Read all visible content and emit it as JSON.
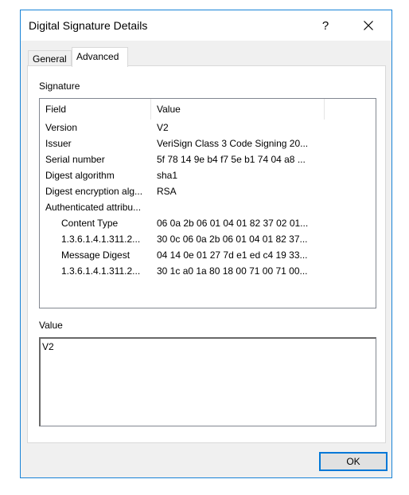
{
  "window": {
    "title": "Digital Signature Details",
    "help_label": "?",
    "close_icon": "close-icon"
  },
  "tabs": [
    {
      "label": "General",
      "selected": false
    },
    {
      "label": "Advanced",
      "selected": true
    }
  ],
  "signature": {
    "group_label": "Signature",
    "columns": [
      "Field",
      "Value"
    ],
    "rows": [
      {
        "field": "Version",
        "value": "V2",
        "indent": false
      },
      {
        "field": "Issuer",
        "value": "VeriSign Class 3 Code Signing 20...",
        "indent": false
      },
      {
        "field": "Serial number",
        "value": "5f 78 14 9e b4 f7 5e b1 74 04 a8 ...",
        "indent": false
      },
      {
        "field": "Digest algorithm",
        "value": "sha1",
        "indent": false
      },
      {
        "field": "Digest encryption alg...",
        "value": "RSA",
        "indent": false
      },
      {
        "field": "Authenticated attribu...",
        "value": "",
        "indent": false
      },
      {
        "field": "Content Type",
        "value": "06 0a 2b 06 01 04 01 82 37 02 01...",
        "indent": true
      },
      {
        "field": "1.3.6.1.4.1.311.2...",
        "value": "30 0c 06 0a 2b 06 01 04 01 82 37...",
        "indent": true
      },
      {
        "field": "Message Digest",
        "value": "04 14 0e 01 27 7d e1 ed c4 19 33...",
        "indent": true
      },
      {
        "field": "1.3.6.1.4.1.311.2...",
        "value": "30 1c a0 1a 80 18 00 71 00 71 00...",
        "indent": true
      }
    ]
  },
  "value_section": {
    "group_label": "Value",
    "text": "V2"
  },
  "footer": {
    "ok_label": "OK"
  },
  "colors": {
    "accent": "#0078d7",
    "window_border": "#1883d7"
  }
}
